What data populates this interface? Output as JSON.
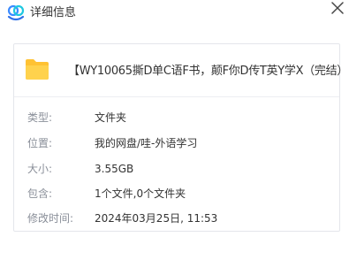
{
  "window": {
    "title": "详细信息",
    "logo_icon": "baidu-netdisk-cloud-icon",
    "close_icon": "close-icon"
  },
  "file": {
    "icon": "folder-icon",
    "icon_color": "#ffc233",
    "name": "【WY10065撕D单C语F书，颠F你D传T英Y学X（完结）"
  },
  "details": [
    {
      "label": "类型:",
      "value": "文件夹",
      "link": false
    },
    {
      "label": "位置:",
      "value": "我的网盘/哇-外语学习",
      "link": true
    },
    {
      "label": "大小:",
      "value": "3.55GB",
      "link": false
    },
    {
      "label": "包含:",
      "value": "1个文件,0个文件夹",
      "link": false
    },
    {
      "label": "修改时间:",
      "value": "2024年03月25日, 11:53",
      "link": false
    }
  ],
  "colors": {
    "label": "#8a8f99",
    "value": "#333333",
    "border": "#e4e6eb"
  }
}
